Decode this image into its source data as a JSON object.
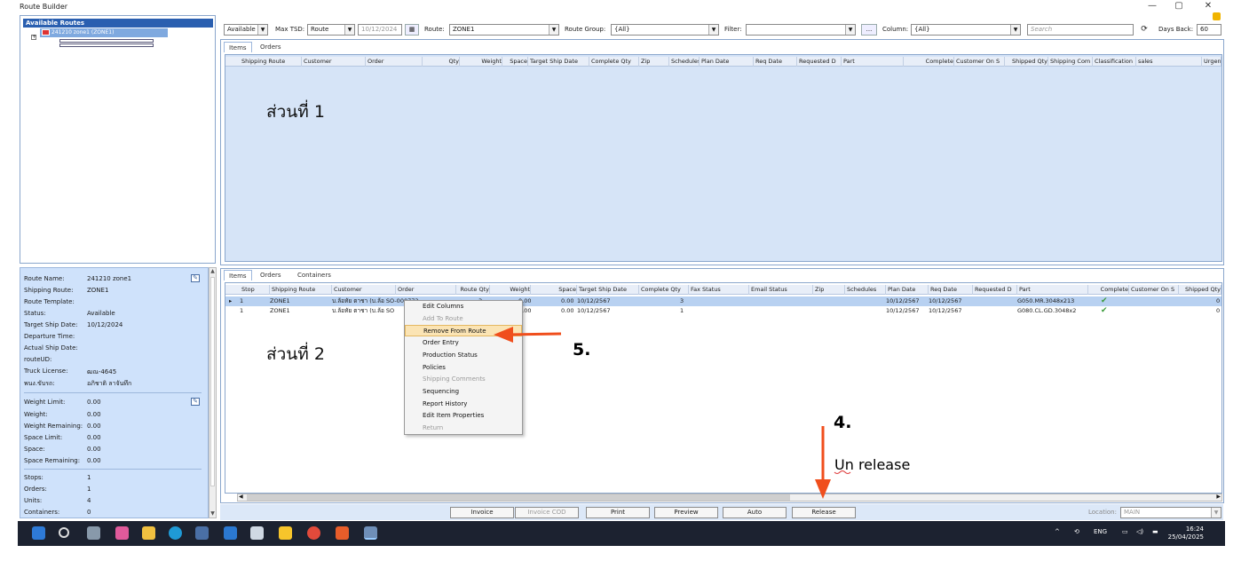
{
  "window": {
    "title": "Route Builder",
    "minimize": "—",
    "restore": "▢",
    "close": "✕"
  },
  "tree": {
    "header": "Available Routes",
    "node_label": "241210 zone1 (ZONE1)",
    "expand_glyph": "+"
  },
  "route_props": [
    {
      "label": "Route Name:",
      "value": "241210 zone1"
    },
    {
      "label": "Shipping Route:",
      "value": "ZONE1"
    },
    {
      "label": "Route Template:",
      "value": ""
    },
    {
      "label": "Status:",
      "value": "Available"
    },
    {
      "label": "Target Ship Date:",
      "value": "10/12/2024"
    },
    {
      "label": "Departure Time:",
      "value": ""
    },
    {
      "label": "Actual Ship Date:",
      "value": ""
    },
    {
      "label": "routeUD:",
      "value": ""
    },
    {
      "label": "Truck License:",
      "value": "ฒณ-4645"
    },
    {
      "label": "พนง.ขับรถ:",
      "value": "อภิชาติ ลาจันทึก"
    }
  ],
  "weight_props": [
    {
      "label": "Weight Limit:",
      "value": "0.00"
    },
    {
      "label": "Weight:",
      "value": "0.00"
    },
    {
      "label": "Weight Remaining:",
      "value": "0.00"
    },
    {
      "label": "Space Limit:",
      "value": "0.00"
    },
    {
      "label": "Space:",
      "value": "0.00"
    },
    {
      "label": "Space Remaining:",
      "value": "0.00"
    }
  ],
  "count_props": [
    {
      "label": "Stops:",
      "value": "1"
    },
    {
      "label": "Orders:",
      "value": "1"
    },
    {
      "label": "Units:",
      "value": "4"
    },
    {
      "label": "Containers:",
      "value": "0"
    }
  ],
  "toolbar": {
    "status_value": "Available",
    "max_tsd_label": "Max TSD:",
    "max_tsd_value": "Route",
    "date_value": "10/12/2024",
    "route_label": "Route:",
    "route_value": "ZONE1",
    "route_group_label": "Route Group:",
    "route_group_value": "{All}",
    "filter_label": "Filter:",
    "filter_value": "",
    "ellipsis": "...",
    "column_label": "Column:",
    "column_value": "{All}",
    "search_placeholder": "Search",
    "days_back_label": "Days Back:",
    "days_back_value": "60"
  },
  "top_tabs": [
    "Items",
    "Orders"
  ],
  "top_columns": [
    "Shipping Route",
    "Customer",
    "Order",
    "Qty",
    "Weight",
    "Space",
    "Target Ship Date",
    "Complete Qty",
    "Zip",
    "Schedules",
    "Plan Date",
    "Req Date",
    "Requested D",
    "Part",
    "Complete",
    "Customer On S",
    "Shipped Qty",
    "Shipping Com",
    "Classification",
    "sales",
    "Urgen"
  ],
  "bottom_tabs": [
    "Items",
    "Orders",
    "Containers"
  ],
  "bottom_columns": [
    "Stop",
    "Shipping Route",
    "Customer",
    "Order",
    "Route Qty",
    "Weight",
    "Space",
    "Target Ship Date",
    "Complete Qty",
    "Fax Status",
    "Email Status",
    "Zip",
    "Schedules",
    "Plan Date",
    "Req Date",
    "Requested D",
    "Part",
    "Complete",
    "Customer On S",
    "Shipped Qty"
  ],
  "bottom_rows": [
    {
      "stop": "1",
      "route": "ZONE1",
      "customer": "บ.ล้อทัย ตาชา (บ.ล้อ SO-000773",
      "route_qty": "3",
      "weight": "0.00",
      "space": "0.00",
      "tsd": "10/12/2567",
      "cqty": "3",
      "plan": "10/12/2567",
      "req": "10/12/2567",
      "part": "G050.MR.3048x213",
      "end": "0"
    },
    {
      "stop": "1",
      "route": "ZONE1",
      "customer": "บ.ล้อทัย ตาชา (บ.ล้อ SO",
      "route_qty": "",
      "weight": "0.00",
      "space": "0.00",
      "tsd": "10/12/2567",
      "cqty": "1",
      "plan": "10/12/2567",
      "req": "10/12/2567",
      "part": "G080.CL.GD.3048x2",
      "end": "0"
    }
  ],
  "context_menu": [
    {
      "label": "Edit Columns",
      "disabled": false
    },
    {
      "label": "Add To Route",
      "disabled": true
    },
    {
      "label": "Remove From Route",
      "disabled": false
    },
    {
      "label": "Order Entry",
      "disabled": false
    },
    {
      "label": "Production Status",
      "disabled": false
    },
    {
      "label": "Policies",
      "disabled": false
    },
    {
      "label": "Shipping Comments",
      "disabled": true
    },
    {
      "label": "Sequencing",
      "disabled": false
    },
    {
      "label": "Report History",
      "disabled": false
    },
    {
      "label": "Edit Item Properties",
      "disabled": false
    },
    {
      "label": "Return",
      "disabled": true
    }
  ],
  "bottom_buttons": [
    "Invoice",
    "Invoice COD",
    "Print",
    "Preview",
    "Auto",
    "Release"
  ],
  "location": {
    "label": "Location:",
    "value": "MAIN"
  },
  "annotations": {
    "section1": "ส่วนที่ 1",
    "section2": "ส่วนที่ 2",
    "step5": "5.",
    "step4": "4.",
    "unrelease": "Un release",
    "arrow_color": "#f04e1c"
  },
  "taskbar": {
    "lang": "ENG",
    "time": "16:24",
    "date": "25/04/2025",
    "chevron": "^"
  }
}
